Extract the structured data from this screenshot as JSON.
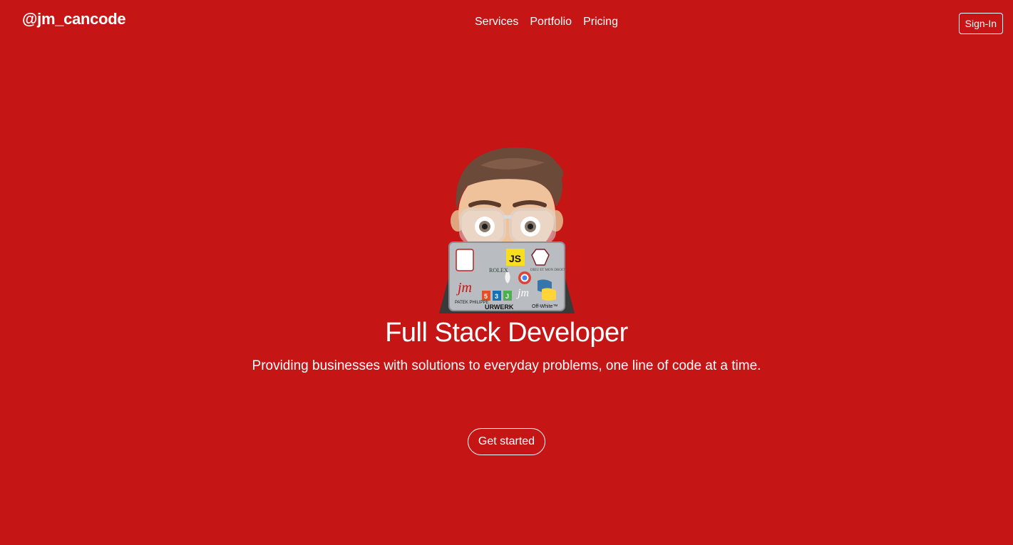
{
  "header": {
    "brand": "@jm_cancode",
    "nav": [
      {
        "label": "Services"
      },
      {
        "label": "Portfolio"
      },
      {
        "label": "Pricing"
      }
    ],
    "signin_label": "Sign-In"
  },
  "hero": {
    "title": "Full Stack Developer",
    "subtitle": "Providing businesses with solutions to everyday problems, one line of code at a time.",
    "cta_label": "Get started",
    "avatar": {
      "icon": "memoji-developer-laptop-icon",
      "laptop_stickers": [
        "JS",
        "ROLEX",
        "HTML",
        "CSS",
        "JS",
        "PATEK PHILIPPE",
        "URWERK",
        "Off-White™",
        "jm"
      ]
    }
  },
  "colors": {
    "background": "#c51515",
    "text": "#ffffff"
  }
}
